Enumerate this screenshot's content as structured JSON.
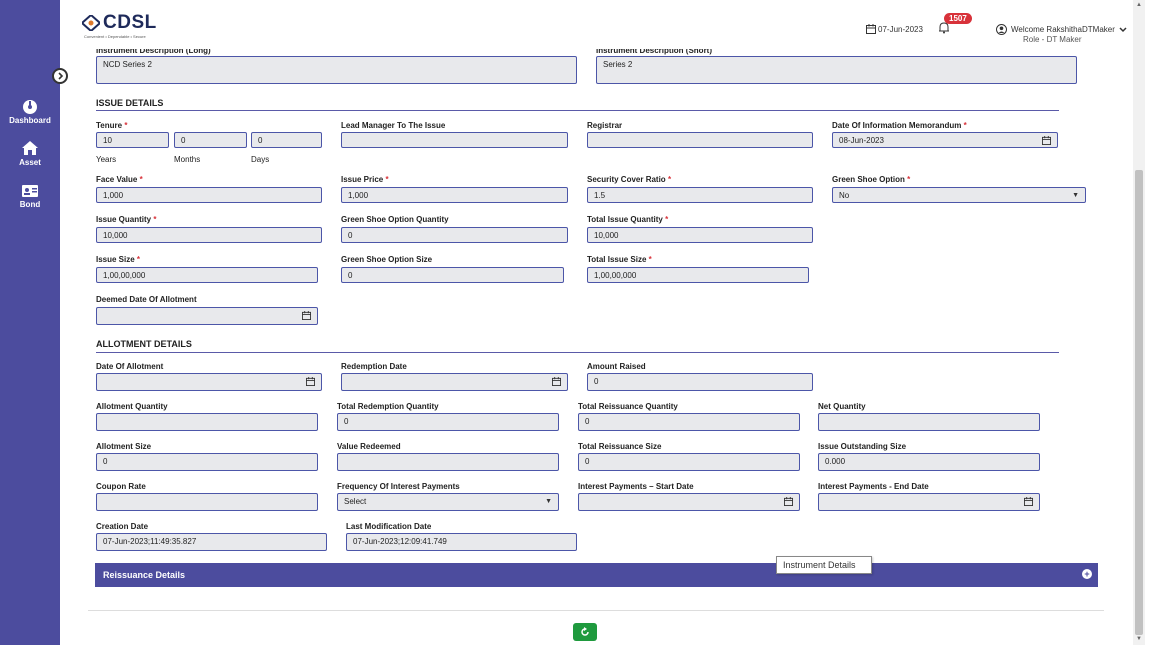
{
  "header": {
    "brand": "CDSL",
    "tagline": "Convenient • Dependable • Secure",
    "date": "07-Jun-2023",
    "notification_count": "1507",
    "welcome": "Welcome RakshithaDTMaker",
    "role": "Role - DT Maker"
  },
  "sidebar": {
    "items": [
      {
        "label": "Dashboard",
        "icon": "dashboard-icon"
      },
      {
        "label": "Asset",
        "icon": "home-icon"
      },
      {
        "label": "Bond",
        "icon": "id-card-icon"
      }
    ]
  },
  "top": {
    "long_desc_label": "Instrument Description (Long)",
    "long_desc_value": "NCD Series 2",
    "short_desc_label": "Instrument Description (Short)",
    "short_desc_value": "Series 2"
  },
  "issue": {
    "title": "ISSUE DETAILS",
    "tenure_label": "Tenure",
    "tenure_years": "10",
    "tenure_months": "0",
    "tenure_days": "0",
    "years": "Years",
    "months": "Months",
    "days": "Days",
    "lead_manager_label": "Lead Manager To The Issue",
    "registrar_label": "Registrar",
    "memo_date_label": "Date Of Information Memorandum",
    "memo_date_value": "08-Jun-2023",
    "face_value_label": "Face Value",
    "face_value": "1,000",
    "issue_price_label": "Issue Price",
    "issue_price": "1,000",
    "security_cover_label": "Security Cover Ratio",
    "security_cover": "1.5",
    "green_shoe_label": "Green Shoe Option",
    "green_shoe": "No",
    "issue_qty_label": "Issue Quantity",
    "issue_qty": "10,000",
    "gs_qty_label": "Green Shoe Option Quantity",
    "gs_qty": "0",
    "total_issue_qty_label": "Total Issue Quantity",
    "total_issue_qty": "10,000",
    "issue_size_label": "Issue Size",
    "issue_size": "1,00,00,000",
    "gs_size_label": "Green Shoe Option Size",
    "gs_size": "0",
    "total_issue_size_label": "Total Issue Size",
    "total_issue_size": "1,00,00,000",
    "deemed_label": "Deemed Date Of Allotment"
  },
  "allotment": {
    "title": "ALLOTMENT DETAILS",
    "date_label": "Date Of Allotment",
    "redemption_label": "Redemption Date",
    "amount_label": "Amount Raised",
    "amount": "0",
    "qty_label": "Allotment Quantity",
    "total_red_qty_label": "Total Redemption Quantity",
    "total_red_qty": "0",
    "total_reiss_qty_label": "Total Reissuance Quantity",
    "total_reiss_qty": "0",
    "net_qty_label": "Net Quantity",
    "size_label": "Allotment Size",
    "size": "0",
    "value_red_label": "Value Redeemed",
    "total_reiss_size_label": "Total Reissuance Size",
    "total_reiss_size": "0",
    "outstanding_label": "Issue Outstanding Size",
    "outstanding": "0.000",
    "coupon_label": "Coupon Rate",
    "freq_label": "Frequency Of Interest Payments",
    "freq_value": "Select",
    "int_start_label": "Interest Payments – Start Date",
    "int_end_label": "Interest Payments - End Date",
    "creation_label": "Creation Date",
    "creation": "07-Jun-2023;11:49:35.827",
    "lastmod_label": "Last Modification Date",
    "lastmod": "07-Jun-2023;12:09:41.749"
  },
  "reissuance_title": "Reissuance Details",
  "tooltip": "Instrument Details",
  "req_mark": "*"
}
